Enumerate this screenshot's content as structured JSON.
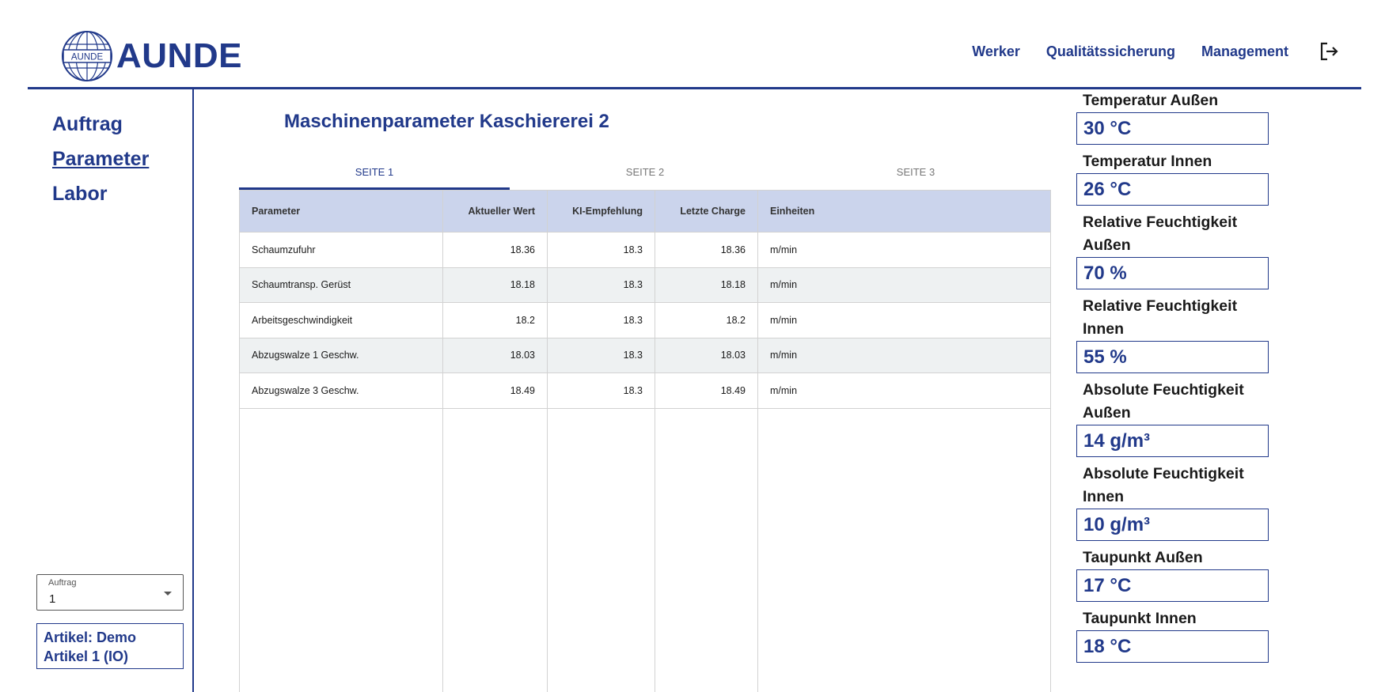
{
  "brand": {
    "name": "AUNDE",
    "globe_text": "AUNDE",
    "brand_color": "#21398a"
  },
  "nav": {
    "items": [
      "Werker",
      "Qualitätssicherung",
      "Management"
    ],
    "logout_icon": "logout-icon"
  },
  "sidebar": {
    "items": [
      "Auftrag",
      "Parameter",
      "Labor"
    ],
    "active_item": "Parameter",
    "auftrag_select": {
      "label": "Auftrag",
      "value": "1"
    },
    "artikel": "Artikel: Demo Artikel 1 (IO)"
  },
  "main": {
    "title": "Maschinenparameter Kaschiererei 2",
    "tabs": [
      "SEITE 1",
      "SEITE 2",
      "SEITE 3"
    ],
    "active_tab": "SEITE 1",
    "table": {
      "columns": [
        "Parameter",
        "Aktueller Wert",
        "KI-Empfehlung",
        "Letzte Charge",
        "Einheiten"
      ],
      "rows": [
        [
          "Schaumzufuhr",
          "18.36",
          "18.3",
          "18.36",
          "m/min"
        ],
        [
          "Schaumtransp. Gerüst",
          "18.18",
          "18.3",
          "18.18",
          "m/min"
        ],
        [
          "Arbeitsgeschwindigkeit",
          "18.2",
          "18.3",
          "18.2",
          "m/min"
        ],
        [
          "Abzugswalze 1 Geschw.",
          "18.03",
          "18.3",
          "18.03",
          "m/min"
        ],
        [
          "Abzugswalze 3 Geschw.",
          "18.49",
          "18.3",
          "18.49",
          "m/min"
        ]
      ]
    }
  },
  "environment": [
    {
      "label": "Temperatur Außen",
      "value": "30 °C"
    },
    {
      "label": "Temperatur Innen",
      "value": "26 °C"
    },
    {
      "label": "Relative Feuchtigkeit Außen",
      "value": "70 %"
    },
    {
      "label": "Relative Feuchtigkeit Innen",
      "value": "55 %"
    },
    {
      "label": "Absolute Feuchtigkeit Außen",
      "value": "14 g/m³"
    },
    {
      "label": "Absolute Feuchtigkeit Innen",
      "value": "10 g/m³"
    },
    {
      "label": "Taupunkt Außen",
      "value": "17 °C"
    },
    {
      "label": "Taupunkt Innen",
      "value": "18 °C"
    }
  ]
}
